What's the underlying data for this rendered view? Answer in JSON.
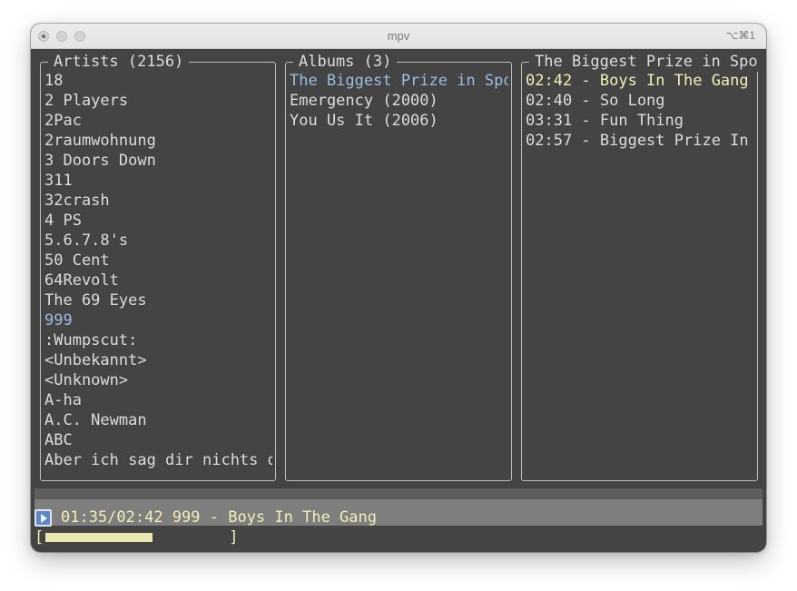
{
  "window": {
    "title": "mpv",
    "shortcut": "⌥⌘1"
  },
  "artists": {
    "title": "Artists (2156)",
    "items": [
      "18",
      "2 Players",
      "2Pac",
      "2raumwohnung",
      "3 Doors Down",
      "311",
      "32crash",
      "4 PS",
      "5.6.7.8's",
      "50 Cent",
      "64Revolt",
      "The 69 Eyes",
      "999",
      ":Wumpscut:",
      "<Unbekannt>",
      "<Unknown>",
      "A-ha",
      "A.C. Newman",
      "ABC",
      "Aber ich sag dir nichts d"
    ],
    "selected": "999"
  },
  "albums": {
    "title": "Albums (3)",
    "items": [
      "The Biggest Prize in Spo",
      "Emergency (2000)",
      "You Us It (2006)"
    ],
    "selected": "The Biggest Prize in Spo"
  },
  "tracks": {
    "title": "The Biggest Prize in Spo",
    "items": [
      "02:42 - Boys In The Gang",
      "02:40 - So Long",
      "03:31 - Fun Thing",
      "02:57 - Biggest Prize In"
    ],
    "playing": "02:42 - Boys In The Gang"
  },
  "status": {
    "icon": "play-icon",
    "text": "01:35/02:42 999 - Boys In The Gang",
    "progress_open": "[",
    "progress_close": "]",
    "progress_fraction": 0.587
  },
  "colors": {
    "background": "#444444",
    "text": "#dcdcdc",
    "selected_blue": "#9dbde0",
    "playing_yellow": "#f2efb6",
    "play_icon": "#5e88c4"
  }
}
